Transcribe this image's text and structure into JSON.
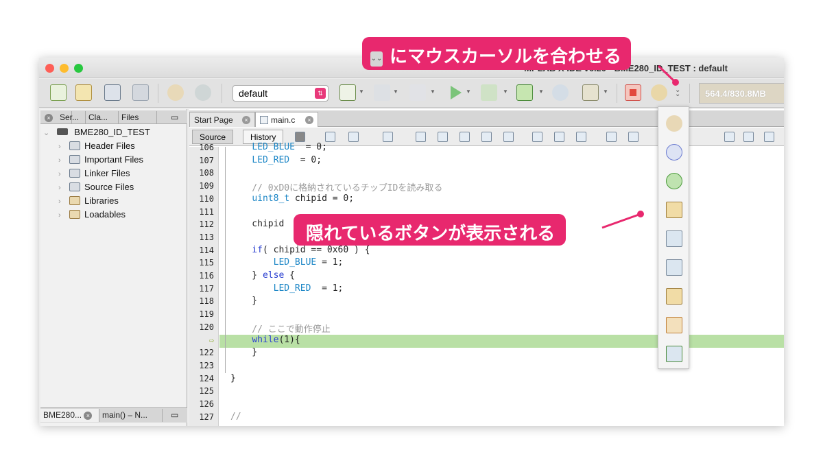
{
  "window": {
    "title": "MPLAB X IDE v6.20 - BME280_ID_TEST : default"
  },
  "toolbar": {
    "configuration_value": "default",
    "memory_label": "564.4/830.8MB"
  },
  "left_panel": {
    "tabs": [
      "Ser...",
      "Cla...",
      "Files"
    ],
    "project_name": "BME280_ID_TEST",
    "folders": [
      "Header Files",
      "Important Files",
      "Linker Files",
      "Source Files",
      "Libraries",
      "Loadables"
    ],
    "bottom_tabs": [
      "BME280...",
      "main() – N..."
    ]
  },
  "editor": {
    "tabs": [
      "Start Page",
      "main.c"
    ],
    "source_button": "Source",
    "history_button": "History",
    "lines": [
      {
        "n": "106",
        "text": "    LED_BLUE  = 0;",
        "parts": [
          [
            "    ",
            ""
          ],
          [
            "LED_BLUE",
            "id"
          ],
          [
            "  = 0;",
            ""
          ]
        ]
      },
      {
        "n": "107",
        "text": "    LED_RED  = 0;",
        "parts": [
          [
            "    ",
            ""
          ],
          [
            "LED_RED",
            "id"
          ],
          [
            "  = 0;",
            ""
          ]
        ]
      },
      {
        "n": "108",
        "text": "",
        "parts": []
      },
      {
        "n": "109",
        "text": "    // 0xD0に格納されているチップIDを読み取る",
        "parts": [
          [
            "    // 0xD0に格納されているチップIDを読み取る",
            "cm"
          ]
        ]
      },
      {
        "n": "110",
        "text": "    uint8_t chipid = 0;",
        "parts": [
          [
            "    ",
            ""
          ],
          [
            "uint8_t",
            "id"
          ],
          [
            " chipid = 0;",
            ""
          ]
        ]
      },
      {
        "n": "111",
        "text": "",
        "parts": []
      },
      {
        "n": "112",
        "text": "    chipid",
        "parts": [
          [
            "    chipid",
            ""
          ]
        ]
      },
      {
        "n": "113",
        "text": "",
        "parts": []
      },
      {
        "n": "114",
        "text": "    if( chipid == 0x60 ) {",
        "parts": [
          [
            "    ",
            ""
          ],
          [
            "if",
            "kw"
          ],
          [
            "( chipid == 0x60 ) {",
            ""
          ]
        ]
      },
      {
        "n": "115",
        "text": "        LED_BLUE = 1;",
        "parts": [
          [
            "        ",
            ""
          ],
          [
            "LED_BLUE",
            "id"
          ],
          [
            " = 1;",
            ""
          ]
        ]
      },
      {
        "n": "116",
        "text": "    } else {",
        "parts": [
          [
            "    } ",
            ""
          ],
          [
            "else",
            "kw"
          ],
          [
            " {",
            ""
          ]
        ]
      },
      {
        "n": "117",
        "text": "        LED_RED  = 1;",
        "parts": [
          [
            "        ",
            ""
          ],
          [
            "LED_RED",
            "id"
          ],
          [
            "  = 1;",
            ""
          ]
        ]
      },
      {
        "n": "118",
        "text": "    }",
        "parts": [
          [
            "    }",
            ""
          ]
        ]
      },
      {
        "n": "119",
        "text": "",
        "parts": []
      },
      {
        "n": "120",
        "text": "    // ここで動作停止",
        "parts": [
          [
            "    // ここで動作停止",
            "cm"
          ]
        ]
      },
      {
        "n": "",
        "text": "    while(1){",
        "parts": [
          [
            "    ",
            ""
          ],
          [
            "while",
            "kw"
          ],
          [
            "(1){",
            ""
          ]
        ]
      },
      {
        "n": "122",
        "text": "    }",
        "parts": [
          [
            "    }",
            ""
          ]
        ]
      },
      {
        "n": "123",
        "text": "",
        "parts": []
      },
      {
        "n": "124",
        "text": "}",
        "parts": [
          [
            "}",
            ""
          ]
        ]
      },
      {
        "n": "125",
        "text": "",
        "parts": []
      },
      {
        "n": "126",
        "text": "",
        "parts": []
      },
      {
        "n": "127",
        "text": "//",
        "parts": [
          [
            "//",
            "cm"
          ]
        ]
      }
    ]
  },
  "annotations": {
    "top_callout": "にマウスカーソルを合わせる",
    "top_callout_icon": "chevron-double-down-icon",
    "middle_callout": "隠れているボタンが表示される"
  },
  "colors": {
    "callout": "#e8286e",
    "current_line": "#b9e0a5"
  }
}
